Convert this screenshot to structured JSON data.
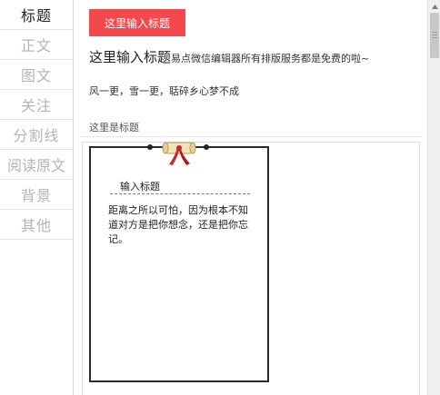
{
  "sidebar": {
    "tabs": [
      {
        "label": "标题"
      },
      {
        "label": "正文"
      },
      {
        "label": "图文"
      },
      {
        "label": "关注"
      },
      {
        "label": "分割线"
      },
      {
        "label": "阅读原文"
      },
      {
        "label": "背景"
      },
      {
        "label": "其他"
      }
    ],
    "active_index": 0
  },
  "main": {
    "title_button_label": "这里输入标题",
    "style_title_big": "这里输入标题",
    "style_title_small": "易点微信编辑器所有排版服务都是免费的啦~",
    "poem": "风一更，雪一更，聒碎乡心梦不成",
    "subtitle": "这里是标题",
    "scroll_card": {
      "heading": "输入标题",
      "body": "距离之所以可怕，因为根本不知道对方是把你想念，还是把你忘记。"
    }
  },
  "colors": {
    "accent": "#f4494c",
    "frame": "#2b2b2b",
    "ribbon": "#c8282e",
    "tab_inactive": "#b4b4b4"
  }
}
